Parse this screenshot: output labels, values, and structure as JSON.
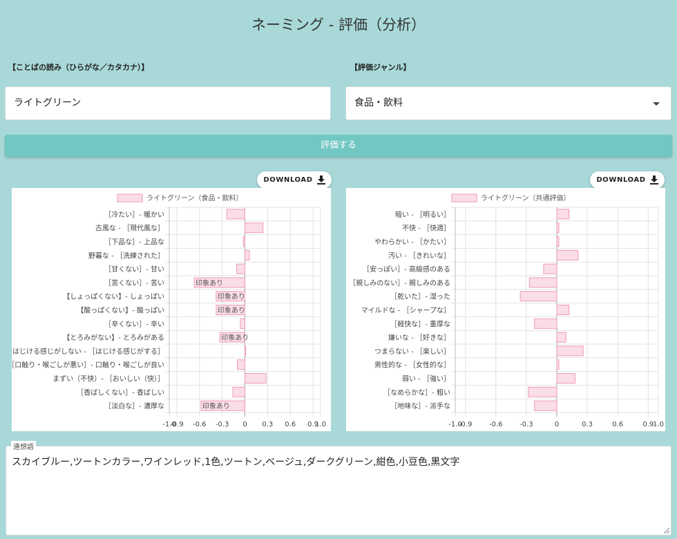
{
  "title": "ネーミング - 評価（分析）",
  "reading_label": "【ことばの読み（ひらがな／カタカナ）】",
  "reading_value": "ライトグリーン",
  "genre_label": "【評価ジャンル】",
  "genre_value": "食品・飲料",
  "evaluate_button": "評価する",
  "download_label": "DOWNLOAD",
  "association_label": "連想語",
  "association_text": "スカイブルー,ツートンカラー,ワインレッド,1色,ツートン,ベージュ,ダークグリーン,紺色,小豆色,黒文字",
  "colors": {
    "background": "#a9d8d8",
    "button": "#71c7c2",
    "bar_fill": "#fbdde6",
    "bar_stroke": "#ee9bb4"
  },
  "chart_data": [
    {
      "type": "bar",
      "orientation": "horizontal",
      "legend": "ライトグリーン（食品・飲料）",
      "legend_position": "top",
      "xlim": [
        -1.0,
        1.0
      ],
      "x_ticks": [
        "-1.0",
        "-0.9",
        "-0.6",
        "-0.3",
        "0",
        "0.3",
        "0.6",
        "0.9",
        "1.0"
      ],
      "x_tick_values": [
        -1.0,
        -0.9,
        -0.6,
        -0.3,
        0,
        0.3,
        0.6,
        0.9,
        1.0
      ],
      "grid": true,
      "categories": [
        "［冷たい］- 暖かい",
        "古風な - ［現代風な］",
        "［下品な］- 上品な",
        "野暮な - ［洗練された］",
        "［甘くない］- 甘い",
        "［苦くない］- 苦い",
        "【しょっぱくない】- しょっぱい",
        "【酸っぱくない】- 酸っぱい",
        "［辛くない］- 辛い",
        "【とろみがない】- とろみがある",
        "はじける感じがしない - ［はじける感じがする］",
        "［口触り・喉ごしが悪い］- 口触り・喉ごしが良い",
        "まずい（不快）- ［おいしい（快）］",
        "［香ばしくない］- 香ばしい",
        "［淡白な］- 濃厚な"
      ],
      "values": [
        -0.24,
        0.24,
        -0.02,
        0.06,
        -0.11,
        -0.67,
        -0.38,
        -0.38,
        -0.06,
        -0.33,
        0,
        -0.1,
        0.28,
        -0.16,
        -0.58
      ],
      "bar_labels": [
        "",
        "",
        "",
        "",
        "",
        "印象あり",
        "印象あり",
        "印象あり",
        "",
        "印象あり",
        "",
        "",
        "",
        "",
        "印象あり"
      ]
    },
    {
      "type": "bar",
      "orientation": "horizontal",
      "legend": "ライトグリーン（共通評価）",
      "legend_position": "top",
      "xlim": [
        -1.0,
        1.0
      ],
      "x_ticks": [
        "-1.0",
        "-0.9",
        "-0.6",
        "-0.3",
        "0",
        "0.3",
        "0.6",
        "0.9",
        "1.0"
      ],
      "x_tick_values": [
        -1.0,
        -0.9,
        -0.6,
        -0.3,
        0,
        0.3,
        0.6,
        0.9,
        1.0
      ],
      "grid": true,
      "categories": [
        "暗い - ［明るい］",
        "不快 - ［快適］",
        "やわらかい - ［かたい］",
        "汚い - ［きれいな］",
        "［安っぽい］- 高級感のある",
        "［親しみのない］- 親しみのある",
        "［乾いた］- 湿った",
        "マイルドな - ［シャープな］",
        "［軽快な］- 重厚な",
        "嫌いな - ［好きな］",
        "つまらない - ［楽しい］",
        "男性的な - ［女性的な］",
        "弱い - ［強い］",
        "［なめらかな］- 粗い",
        "［地味な］- 派手な"
      ],
      "values": [
        0.12,
        0.02,
        0.02,
        0.21,
        -0.13,
        -0.27,
        -0.36,
        0.12,
        -0.22,
        0.09,
        0.26,
        0.02,
        0.18,
        -0.28,
        -0.22
      ],
      "bar_labels": [
        "",
        "",
        "",
        "",
        "",
        "",
        "",
        "",
        "",
        "",
        "",
        "",
        "",
        "",
        ""
      ]
    }
  ]
}
